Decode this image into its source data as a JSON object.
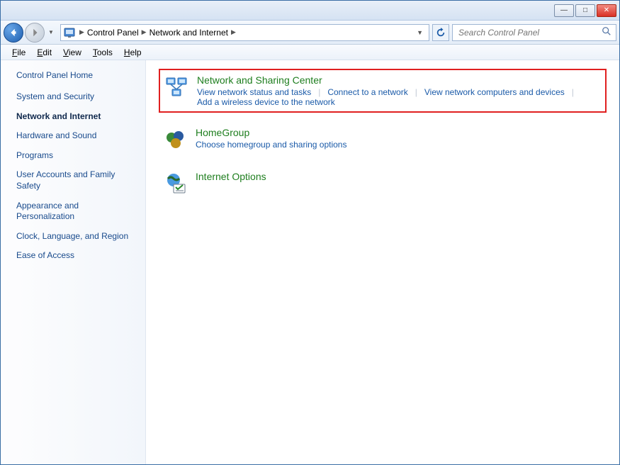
{
  "titlebar": {
    "minimize": "—",
    "maximize": "□",
    "close": "✕"
  },
  "address": {
    "crumb1": "Control Panel",
    "crumb2": "Network and Internet"
  },
  "search": {
    "placeholder": "Search Control Panel"
  },
  "menu": {
    "file": "File",
    "edit": "Edit",
    "view": "View",
    "tools": "Tools",
    "help": "Help"
  },
  "sidebar": {
    "home": "Control Panel Home",
    "items": [
      "System and Security",
      "Network and Internet",
      "Hardware and Sound",
      "Programs",
      "User Accounts and Family Safety",
      "Appearance and Personalization",
      "Clock, Language, and Region",
      "Ease of Access"
    ]
  },
  "sections": [
    {
      "title": "Network and Sharing Center",
      "links": [
        "View network status and tasks",
        "Connect to a network",
        "View network computers and devices",
        "Add a wireless device to the network"
      ]
    },
    {
      "title": "HomeGroup",
      "links": [
        "Choose homegroup and sharing options"
      ]
    },
    {
      "title": "Internet Options",
      "links": []
    }
  ]
}
